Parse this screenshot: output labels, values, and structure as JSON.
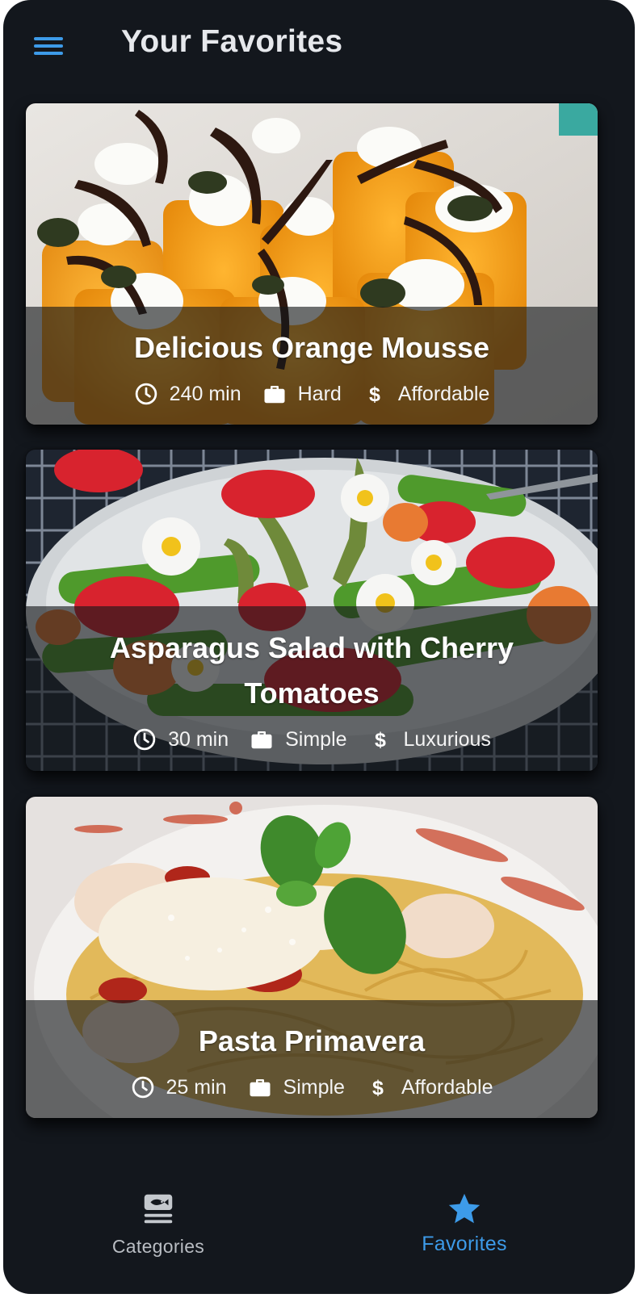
{
  "app_bar": {
    "title": "Your Favorites",
    "menu_icon": "hamburger-menu-icon",
    "accent_color": "#3d9be9"
  },
  "recipes": [
    {
      "title": "Delicious Orange Mousse",
      "duration": "240 min",
      "complexity": "Hard",
      "affordability": "Affordable",
      "image": "orange-mousse-photo"
    },
    {
      "title": "Asparagus Salad with Cherry Tomatoes",
      "duration": "30 min",
      "complexity": "Simple",
      "affordability": "Luxurious",
      "image": "asparagus-salad-photo"
    },
    {
      "title": "Pasta Primavera",
      "duration": "25 min",
      "complexity": "Simple",
      "affordability": "Affordable",
      "image": "pasta-primavera-photo"
    }
  ],
  "icons": {
    "duration": "clock-icon",
    "complexity": "briefcase-icon",
    "affordability": "dollar-icon"
  },
  "bottom_nav": {
    "items": [
      {
        "label": "Categories",
        "icon": "food-set-meal-icon",
        "active": false,
        "color": "#b9bdc3"
      },
      {
        "label": "Favorites",
        "icon": "star-icon",
        "active": true,
        "color": "#3d9be9"
      }
    ]
  },
  "colors": {
    "background": "#13171d",
    "overlay": "rgba(20,22,26,0.62)",
    "text": "#ffffff"
  }
}
